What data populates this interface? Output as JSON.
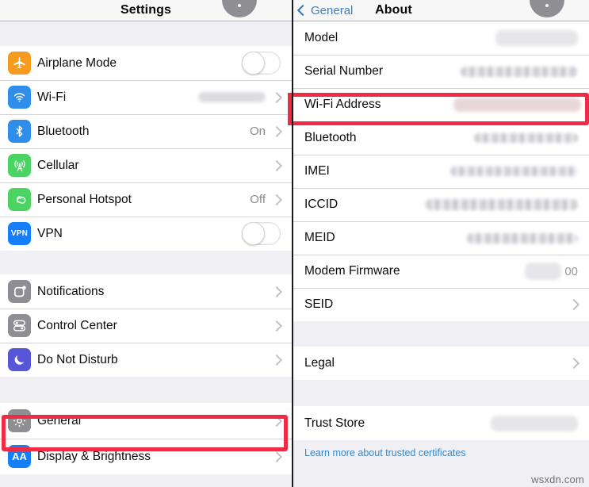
{
  "left_panel": {
    "nav": {
      "title": "Settings"
    },
    "groups": [
      {
        "rows": [
          {
            "label": "Airplane Mode",
            "icon": "airplane-icon",
            "icon_color": "#f79a20",
            "control": "toggle",
            "toggle_on": false
          },
          {
            "label": "Wi-Fi",
            "icon": "wifi-icon",
            "icon_color": "#2f8eea",
            "control": "redacted-chevron",
            "value": ""
          },
          {
            "label": "Bluetooth",
            "icon": "bluetooth-icon",
            "icon_color": "#2f8eea",
            "control": "value-chevron",
            "value": "On"
          },
          {
            "label": "Cellular",
            "icon": "cellular-icon",
            "icon_color": "#4bd363",
            "control": "chevron",
            "value": ""
          },
          {
            "label": "Personal Hotspot",
            "icon": "hotspot-icon",
            "icon_color": "#4bd363",
            "control": "value-chevron",
            "value": "Off"
          },
          {
            "label": "VPN",
            "icon": "vpn-icon",
            "icon_color": "#147efb",
            "icon_text": "VPN",
            "control": "toggle",
            "toggle_on": false
          }
        ]
      },
      {
        "rows": [
          {
            "label": "Notifications",
            "icon": "notifications-icon",
            "icon_color": "#8e8e93",
            "control": "chevron",
            "value": ""
          },
          {
            "label": "Control Center",
            "icon": "control-center-icon",
            "icon_color": "#8e8e93",
            "control": "chevron",
            "value": ""
          },
          {
            "label": "Do Not Disturb",
            "icon": "do-not-disturb-icon",
            "icon_color": "#5756d6",
            "control": "chevron",
            "value": ""
          }
        ]
      },
      {
        "rows": [
          {
            "label": "General",
            "icon": "gear-icon",
            "icon_color": "#8e8e93",
            "control": "chevron",
            "value": "",
            "highlighted": true
          },
          {
            "label": "Display & Brightness",
            "icon": "display-brightness-icon",
            "icon_color": "#147efb",
            "icon_text": "AA",
            "control": "chevron",
            "value": ""
          }
        ]
      }
    ]
  },
  "right_panel": {
    "nav": {
      "back_label": "General",
      "title": "About"
    },
    "groups": [
      {
        "rows": [
          {
            "label": "Model",
            "control": "redacted",
            "value": "",
            "redact_width": 104,
            "redact_height": 20,
            "redact_style": "soft"
          },
          {
            "label": "Serial Number",
            "control": "redacted",
            "value": "",
            "redact_width": 148,
            "redact_height": 13,
            "redact_style": "mottled"
          },
          {
            "label": "Wi-Fi Address",
            "control": "redacted",
            "value": "",
            "redact_width": 161,
            "redact_height": 18,
            "redact_style": "pinkish",
            "highlighted": true
          },
          {
            "label": "Bluetooth",
            "control": "redacted",
            "value": "",
            "redact_width": 131,
            "redact_height": 12,
            "redact_style": "mottled"
          },
          {
            "label": "IMEI",
            "control": "redacted",
            "value": "",
            "redact_width": 161,
            "redact_height": 12,
            "redact_style": "mottled"
          },
          {
            "label": "ICCID",
            "control": "redacted",
            "value": "",
            "redact_width": 192,
            "redact_height": 14,
            "redact_style": "mottled"
          },
          {
            "label": "MEID",
            "control": "redacted",
            "value": "",
            "redact_width": 140,
            "redact_height": 13,
            "redact_style": "mottled"
          },
          {
            "label": "Modem Firmware",
            "control": "redacted-suffix",
            "value": "00",
            "redact_width": 46,
            "redact_height": 22,
            "redact_style": "soft"
          },
          {
            "label": "SEID",
            "control": "chevron",
            "value": ""
          }
        ]
      },
      {
        "rows": [
          {
            "label": "Legal",
            "control": "chevron",
            "value": ""
          }
        ]
      },
      {
        "rows": [
          {
            "label": "Trust Store",
            "control": "redacted",
            "value": "",
            "redact_width": 110,
            "redact_height": 20,
            "redact_style": "soft"
          }
        ]
      }
    ],
    "footer_link": "Learn more about trusted certificates"
  },
  "watermark": "wsxdn.com",
  "colors": {
    "ios_blue": "#3c7fc1",
    "annotation_red": "#ef2b45",
    "group_bg": "#efeff4",
    "row_bg": "#ffffff"
  }
}
